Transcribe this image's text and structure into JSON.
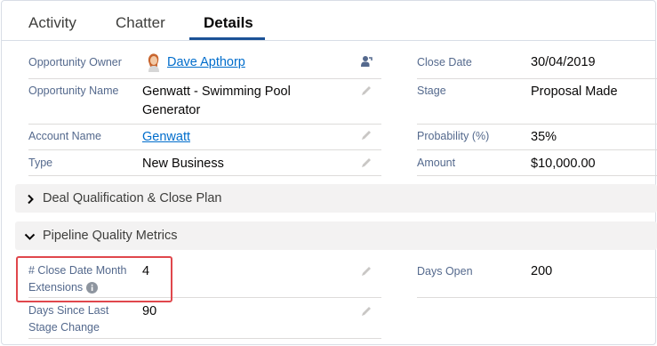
{
  "tabs": [
    {
      "label": "Activity"
    },
    {
      "label": "Chatter"
    },
    {
      "label": "Details",
      "active": true
    }
  ],
  "fields_left": [
    {
      "label": "Opportunity Owner",
      "value": "Dave Apthorp",
      "is_link": true
    },
    {
      "label": "Opportunity Name",
      "value_line1": "Genwatt - Swimming Pool",
      "value_line2": "Generator"
    },
    {
      "label": "Account Name",
      "value": "Genwatt",
      "is_link": true
    },
    {
      "label": "Type",
      "value": "New Business"
    }
  ],
  "fields_right": [
    {
      "label": "Close Date",
      "value": "30/04/2019"
    },
    {
      "label": "Stage",
      "value": "Proposal Made"
    },
    {
      "label": "Probability (%)",
      "value": "35%"
    },
    {
      "label": "Amount",
      "value": "$10,000.00"
    }
  ],
  "sections": {
    "deal": {
      "title": "Deal Qualification & Close Plan",
      "expanded": false
    },
    "pipeline": {
      "title": "Pipeline Quality Metrics",
      "expanded": true
    }
  },
  "pipeline_fields": {
    "close_date_ext": {
      "label_line1": "# Close Date Month",
      "label_line2": "Extensions",
      "value": "4",
      "highlighted": true
    },
    "days_open": {
      "label": "Days Open",
      "value": "200"
    },
    "days_since": {
      "label_line1": "Days Since Last",
      "label_line2": "Stage Change",
      "value": "90"
    }
  },
  "icons": {
    "owner_avatar": "user-avatar-icon",
    "change_owner": "change-owner-icon",
    "edit": "pencil-icon",
    "info": "info-icon",
    "chevron_right": "chevron-right-icon",
    "chevron_down": "chevron-down-icon"
  },
  "colors": {
    "link": "#006dcc",
    "tab_active_underline": "#1b5297",
    "highlight_border": "#e0474c",
    "section_bg": "#f3f2f2"
  }
}
